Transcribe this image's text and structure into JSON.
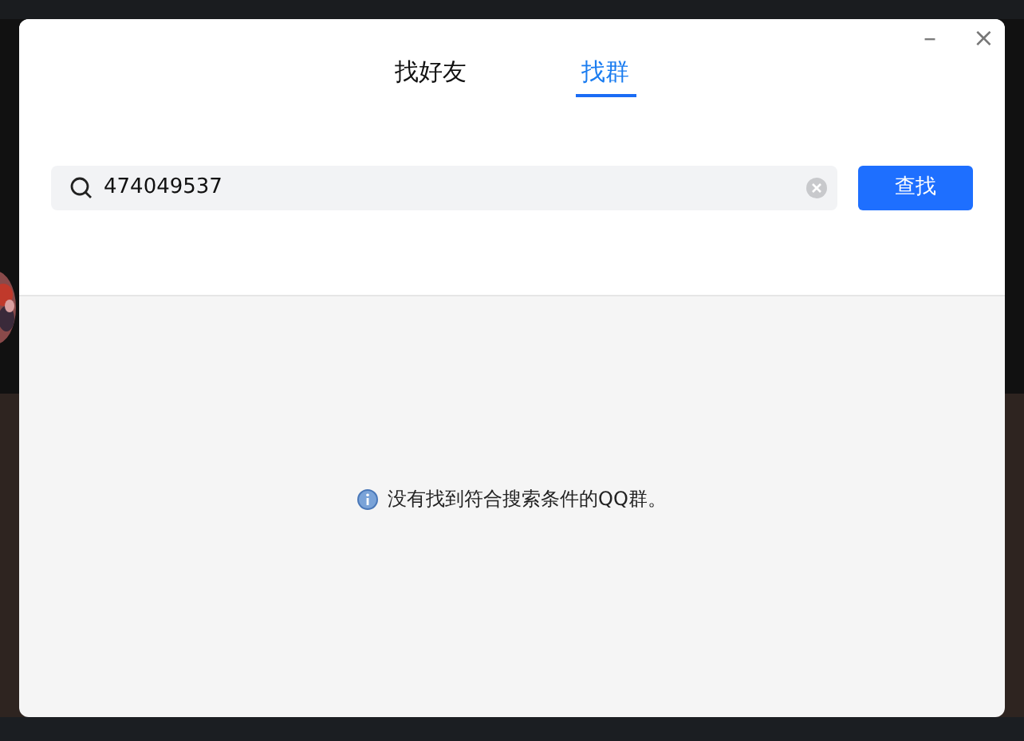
{
  "window": {
    "minimize": "–",
    "close": "×"
  },
  "tabs": [
    {
      "label": "找好友",
      "selected": false
    },
    {
      "label": "找群",
      "selected": true
    }
  ],
  "search": {
    "value": "474049537"
  },
  "search_button": "查找",
  "message": "没有找到符合搜索条件的QQ群。"
}
